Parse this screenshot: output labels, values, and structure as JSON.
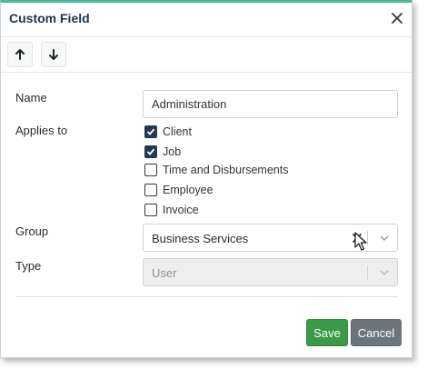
{
  "dialog": {
    "title": "Custom Field"
  },
  "toolbar": {
    "up_icon": "arrow-up-icon",
    "down_icon": "arrow-down-icon",
    "close_icon": "close-icon"
  },
  "form": {
    "name": {
      "label": "Name",
      "value": "Administration"
    },
    "applies_to": {
      "label": "Applies to",
      "options": [
        {
          "label": "Client",
          "checked": true
        },
        {
          "label": "Job",
          "checked": true
        },
        {
          "label": "Time and Disbursements",
          "checked": false
        },
        {
          "label": "Employee",
          "checked": false
        },
        {
          "label": "Invoice",
          "checked": false
        }
      ]
    },
    "group": {
      "label": "Group",
      "value": "Business Services"
    },
    "type": {
      "label": "Type",
      "value": "User",
      "disabled": true
    }
  },
  "actions": {
    "save_label": "Save",
    "cancel_label": "Cancel"
  },
  "colors": {
    "accent_top": "#4fb59a",
    "save": "#3a9a4a",
    "cancel": "#6c757d",
    "checkbox_checked": "#243a52"
  }
}
